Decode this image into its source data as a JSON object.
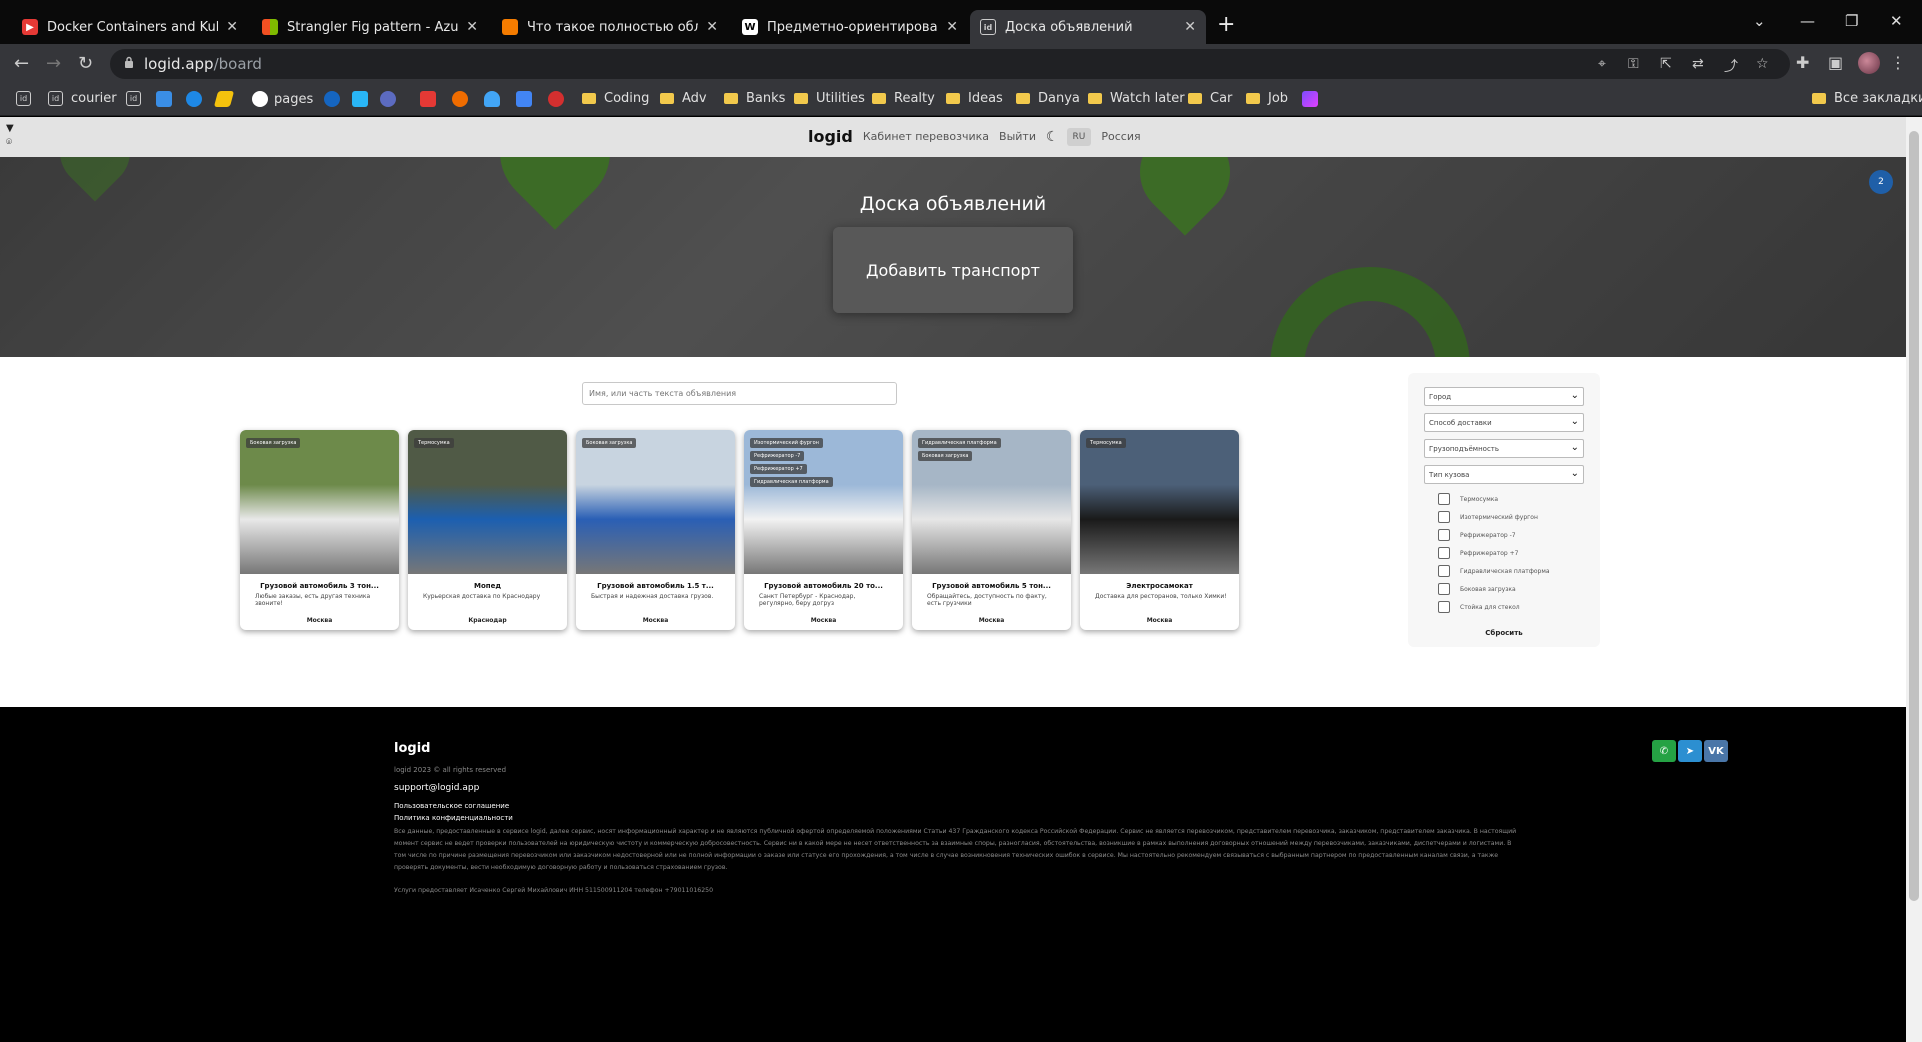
{
  "browser": {
    "tabs": [
      {
        "title": "Docker Containers and Kuberne",
        "favicon_color": "#e53935"
      },
      {
        "title": "Strangler Fig pattern - Azure Arc",
        "favicon_color": "#2a7ae2"
      },
      {
        "title": "Что такое полностью облачна",
        "favicon_color": "#f57c00"
      },
      {
        "title": "Предметно-ориентированное",
        "favicon_color": "#ffffff"
      },
      {
        "title": "Доска объявлений",
        "favicon_color": "#cccccc"
      }
    ],
    "new_tab_icon": "+",
    "url_host": "logid.app",
    "url_path": "/board",
    "bookmarks": [
      {
        "label": "",
        "type": "id"
      },
      {
        "label": "",
        "type": "id"
      },
      {
        "label": "courier",
        "type": "id"
      },
      {
        "label": "",
        "type": "id"
      },
      {
        "label": "pages",
        "type": "globe"
      },
      {
        "label": "Coding",
        "type": "folder"
      },
      {
        "label": "Adv",
        "type": "folder"
      },
      {
        "label": "Banks",
        "type": "folder"
      },
      {
        "label": "Utilities",
        "type": "folder"
      },
      {
        "label": "Realty",
        "type": "folder"
      },
      {
        "label": "Ideas",
        "type": "folder"
      },
      {
        "label": "Danya",
        "type": "folder"
      },
      {
        "label": "Watch later",
        "type": "folder"
      },
      {
        "label": "Car",
        "type": "folder"
      },
      {
        "label": "Job",
        "type": "folder"
      }
    ],
    "all_bookmarks_label": "Все закладки"
  },
  "header": {
    "logo": "logid",
    "links": [
      "Кабинет перевозчика",
      "Выйти"
    ],
    "language": "RU",
    "region": "Россия"
  },
  "hero": {
    "title": "Доска объявлений",
    "add_button": "Добавить транспорт",
    "notification_count": "2"
  },
  "search": {
    "placeholder": "Имя, или часть текста объявления"
  },
  "cards": [
    {
      "name": "Грузовой автомобиль 3 тон...",
      "desc": "Любые заказы, есть другая техника звоните!",
      "city": "Москва",
      "tags": [
        "Боковая загрузка"
      ],
      "palette": [
        "#6d8a4a",
        "#e8e8e8"
      ]
    },
    {
      "name": "Мопед",
      "desc": "Курьерская доставка по Краснодару",
      "city": "Краснодар",
      "tags": [
        "Термосумка"
      ],
      "palette": [
        "#505a46",
        "#1c5fb0"
      ]
    },
    {
      "name": "Грузовой автомобиль 1.5 т...",
      "desc": "Быстрая и надежная доставка грузов.",
      "city": "Москва",
      "tags": [
        "Боковая загрузка"
      ],
      "palette": [
        "#c8d4e0",
        "#2a5fb5"
      ]
    },
    {
      "name": "Грузовой автомобиль 20 то...",
      "desc": "Санкт Петербург - Краснодар, регулярно, беру догруз",
      "city": "Москва",
      "tags": [
        "Изотермический фургон",
        "Рефрижератор -7",
        "Рефрижератор +7",
        "Гидравлическая платформа"
      ],
      "palette": [
        "#9cb8d8",
        "#f2f2f2"
      ]
    },
    {
      "name": "Грузовой автомобиль 5 тон...",
      "desc": "Обращайтесь, доступность по факту, есть грузчики",
      "city": "Москва",
      "tags": [
        "Гидравлическая платформа",
        "Боковая загрузка"
      ],
      "palette": [
        "#a6b6c6",
        "#e6e6e6"
      ]
    },
    {
      "name": "Электросамокат",
      "desc": "Доставка для ресторанов, только Химки!",
      "city": "Москва",
      "tags": [
        "Термосумка"
      ],
      "palette": [
        "#4c6078",
        "#1a1a1a"
      ]
    }
  ],
  "filters": {
    "selects": [
      "Город",
      "Способ доставки",
      "Грузоподъёмность",
      "Тип кузова"
    ],
    "body_types": [
      "Термосумка",
      "Изотермический фургон",
      "Рефрижератор -7",
      "Рефрижератор +7",
      "Гидравлическая платформа",
      "Боковая загрузка",
      "Стойка для стекол"
    ],
    "reset_label": "Сбросить"
  },
  "footer": {
    "logo": "logid",
    "copyright": "logid 2023 © all rights reserved",
    "email": "support@logid.app",
    "links": [
      "Пользовательское соглашение",
      "Политика конфиденциальности"
    ],
    "legal_text": "Все данные, предоставленные в сервисе logid, далее сервис, носят информационный характер и не являются публичной офертой определяемой положениями Статьи 437 Гражданского кодекса Российской Федерации. Сервис не является перевозчиком, представителем перевозчика, заказчиком, представителем заказчика. В настоящий момент сервис не ведет проверки пользователей на юридическую чистоту и коммерческую добросовестность. Сервис ни в какой мере не несет ответственность за взаимные споры, разногласия, обстоятельства, возникшие в рамках выполнения договорных отношений между перевозчиками, заказчиками, диспетчерами и логистами. В том числе по причине размещения перевозчиком или заказчиком недостоверной или не полной информации о заказе или статусе его прохождения, а том числе в случае возникновения технических ошибок в сервисе. Мы настоятельно рекомендуем связываться с выбранным партнером по предоставленным каналам связи, а также проверять документы, вести необходимую договорную работу и пользоваться страхованием грузов.",
    "owner_text": "Услуги предоставляет Исаченко Сергей Михайлович ИНН 511500911204 телефон +79011016250",
    "socials": [
      {
        "name": "whatsapp",
        "color": "#25a244",
        "glyph": "✆"
      },
      {
        "name": "telegram",
        "color": "#2c8fd1",
        "glyph": "➤"
      },
      {
        "name": "vk",
        "color": "#4a76a8",
        "glyph": "VK"
      }
    ]
  }
}
